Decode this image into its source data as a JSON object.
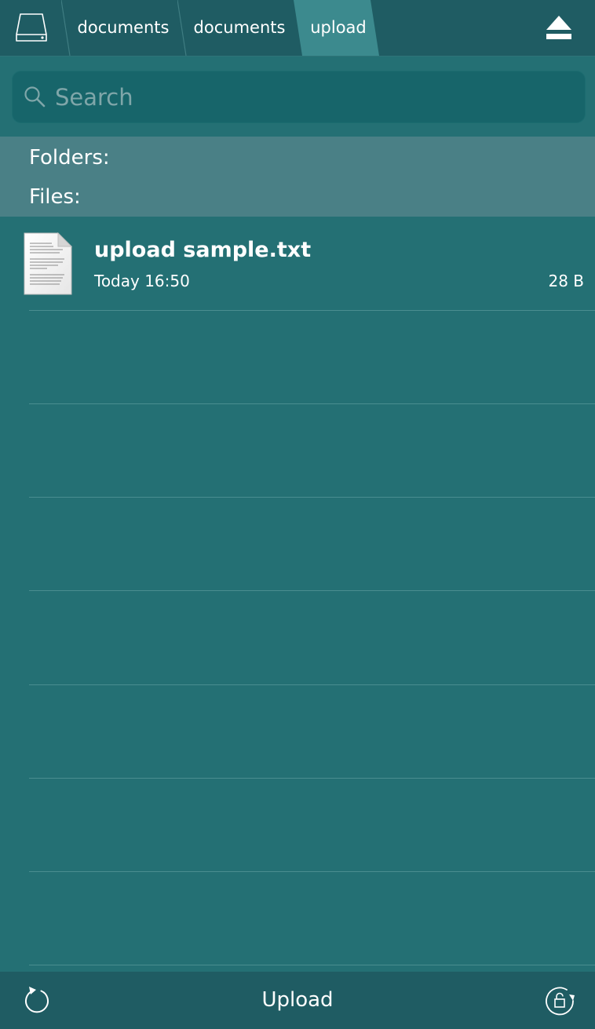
{
  "breadcrumbs": [
    "documents",
    "documents",
    "upload"
  ],
  "search": {
    "placeholder": "Search"
  },
  "sections": {
    "folders": "Folders:",
    "files": "Files:"
  },
  "files": [
    {
      "name": "upload sample.txt",
      "date": "Today 16:50",
      "size": "28 B"
    }
  ],
  "bottom": {
    "upload_label": "Upload"
  },
  "icons": {
    "disk": "disk-icon",
    "eject": "eject-icon",
    "search": "search-icon",
    "document": "text-document-icon",
    "refresh": "refresh-icon",
    "rotation_lock": "rotation-lock-icon"
  },
  "colors": {
    "background": "#247074",
    "topbar": "#1f5c63",
    "active_crumb": "#3c8a8e",
    "section_header": "#4a8086",
    "search_field": "#17656a"
  }
}
